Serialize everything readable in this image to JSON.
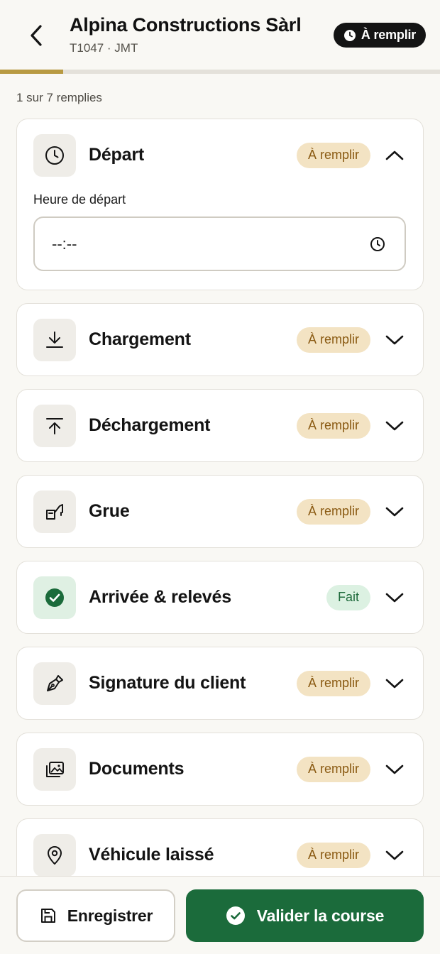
{
  "header": {
    "title": "Alpina Constructions Sàrl",
    "subtitle": "T1047 · JMT",
    "status_badge": "À remplir"
  },
  "progress": {
    "filled": 1,
    "total": 7,
    "fraction": 0.1429
  },
  "count_text": "1 sur 7 remplies",
  "sections": [
    {
      "title": "Départ",
      "badge": "À remplir",
      "icon": "clock-icon",
      "expanded": true,
      "field_label": "Heure de départ",
      "field_value": "--:--"
    },
    {
      "title": "Chargement",
      "badge": "À remplir",
      "icon": "download-icon",
      "expanded": false
    },
    {
      "title": "Déchargement",
      "badge": "À remplir",
      "icon": "upload-icon",
      "expanded": false
    },
    {
      "title": "Grue",
      "badge": "À remplir",
      "icon": "crane-icon",
      "expanded": false
    },
    {
      "title": "Arrivée & relevés",
      "badge": "Fait",
      "icon": "check-circle-icon",
      "expanded": false
    },
    {
      "title": "Signature du client",
      "badge": "À remplir",
      "icon": "pen-icon",
      "expanded": false
    },
    {
      "title": "Documents",
      "badge": "À remplir",
      "icon": "images-icon",
      "expanded": false
    },
    {
      "title": "Véhicule laissé",
      "badge": "À remplir",
      "icon": "map-pin-icon",
      "expanded": false
    }
  ],
  "footer": {
    "save_label": "Enregistrer",
    "validate_label": "Valider la course"
  },
  "colors": {
    "accent_green": "#1b6b3b",
    "progress_gold": "#b89a42",
    "pending_badge_bg": "#f3e3c3",
    "pending_badge_text": "#8a5a12",
    "done_badge_bg": "#dcf1e2"
  }
}
